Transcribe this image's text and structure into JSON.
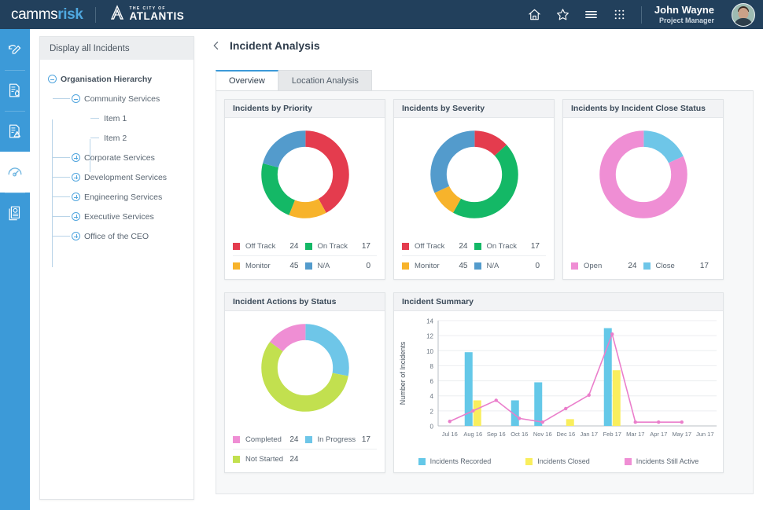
{
  "header": {
    "brand_camms": "camms",
    "brand_risk": "risk",
    "city_sub": "THE CITY OF",
    "city_main": "ATLANTIS",
    "icons": [
      "home-icon",
      "star-icon",
      "hamburger-icon",
      "grid-apps-icon"
    ],
    "user_name": "John Wayne",
    "user_role": "Project Manager"
  },
  "rail": {
    "items": [
      {
        "name": "refresh-edit-icon",
        "active": false
      },
      {
        "name": "document-hand-icon",
        "active": false
      },
      {
        "name": "document-warning-icon",
        "active": false
      },
      {
        "name": "gauge-dashboard-icon",
        "active": true
      },
      {
        "name": "report-badge-icon",
        "active": false
      }
    ]
  },
  "left_panel": {
    "title": "Display all Incidents",
    "tree": [
      {
        "label": "Organisation Hierarchy",
        "state": "expanded",
        "depth": 0,
        "root": true
      },
      {
        "label": "Community Services",
        "state": "expanded",
        "depth": 1,
        "root": false
      },
      {
        "label": "Item 1",
        "state": "leaf",
        "depth": 2,
        "root": false
      },
      {
        "label": "Item 2",
        "state": "leaf",
        "depth": 2,
        "root": false
      },
      {
        "label": "Corporate Services",
        "state": "collapsed",
        "depth": 1,
        "root": false
      },
      {
        "label": "Development Services",
        "state": "collapsed",
        "depth": 1,
        "root": false
      },
      {
        "label": "Engineering Services",
        "state": "collapsed",
        "depth": 1,
        "root": false
      },
      {
        "label": "Executive Services",
        "state": "collapsed",
        "depth": 1,
        "root": false
      },
      {
        "label": "Office of the CEO",
        "state": "collapsed",
        "depth": 1,
        "root": false
      }
    ]
  },
  "main": {
    "back_icon": "chevron-left-icon",
    "page_title": "Incident Analysis",
    "tabs": [
      {
        "label": "Overview",
        "active": true
      },
      {
        "label": "Location Analysis",
        "active": false
      }
    ]
  },
  "colors": {
    "header_bg": "#22405c",
    "rail_bg": "#3c9ad8",
    "accent": "#3c9ad8",
    "red": "#e43c4e",
    "green": "#14b866",
    "orange": "#f7b32b",
    "blue": "#539bcc",
    "pink": "#ef8ed4",
    "lightblue": "#6ec6e8",
    "lime": "#c2e04f",
    "bar_blue": "#64c8e8",
    "bar_yellow": "#f9ee5d",
    "line_pink": "#ea7ecb"
  },
  "chart_data": [
    {
      "type": "pie",
      "id": "incidents-by-priority",
      "title": "Incidents by Priority",
      "labels": [
        "Off Track",
        "On Track",
        "Monitor",
        "N/A"
      ],
      "values": [
        24,
        17,
        45,
        0
      ],
      "colors": [
        "#e43c4e",
        "#14b866",
        "#f7b32b",
        "#539bcc"
      ],
      "slice_order": [
        "Off Track",
        "Monitor",
        "On Track",
        "N/A"
      ],
      "slice_pct": [
        42,
        14,
        23,
        12
      ],
      "legend_position": "bottom",
      "donut": true
    },
    {
      "type": "pie",
      "id": "incidents-by-severity",
      "title": "Incidents by Severity",
      "labels": [
        "Off Track",
        "On Track",
        "Monitor",
        "N/A"
      ],
      "values": [
        24,
        17,
        45,
        0
      ],
      "colors": [
        "#e43c4e",
        "#14b866",
        "#f7b32b",
        "#539bcc"
      ],
      "slice_order": [
        "Off Track",
        "On Track",
        "Monitor",
        "N/A"
      ],
      "slice_pct": [
        13,
        45,
        10,
        32
      ],
      "legend_position": "bottom",
      "donut": true
    },
    {
      "type": "pie",
      "id": "incidents-by-incident-close-status",
      "title": "Incidents by Incident Close Status",
      "labels": [
        "Open",
        "Close"
      ],
      "values": [
        24,
        17
      ],
      "colors": [
        "#ef8ed4",
        "#6ec6e8"
      ],
      "slice_order": [
        "Close",
        "Open"
      ],
      "slice_pct": [
        18,
        82
      ],
      "legend_position": "bottom",
      "donut": true
    },
    {
      "type": "pie",
      "id": "incident-actions-by-status",
      "title": "Incident Actions by Status",
      "labels": [
        "Completed",
        "In Progress",
        "Not Started"
      ],
      "values": [
        24,
        17,
        24
      ],
      "colors": [
        "#ef8ed4",
        "#6ec6e8",
        "#c2e04f"
      ],
      "slice_order": [
        "In Progress",
        "Not Started",
        "Completed"
      ],
      "slice_pct": [
        28,
        57,
        15
      ],
      "legend_position": "bottom",
      "donut": true
    },
    {
      "type": "bar",
      "id": "incident-summary",
      "title": "Incident Summary",
      "xlabel": "",
      "ylabel": "Number of Incidents",
      "ylim": [
        0,
        14
      ],
      "yticks": [
        0,
        2,
        4,
        6,
        8,
        10,
        12,
        14
      ],
      "grid": true,
      "categories": [
        "Jul 16",
        "Aug 16",
        "Sep 16",
        "Oct 16",
        "Nov 16",
        "Dec 16",
        "Jan 17",
        "Feb 17",
        "Mar 17",
        "Apr 17",
        "May 17",
        "Jun 17"
      ],
      "series": [
        {
          "name": "Incidents  Recorded",
          "type": "bar",
          "color": "#64c8e8",
          "values": [
            0,
            9.8,
            0,
            3.4,
            5.8,
            0,
            0,
            13,
            0,
            0,
            0,
            0
          ]
        },
        {
          "name": "Incidents Closed",
          "type": "bar",
          "color": "#f9ee5d",
          "values": [
            0,
            3.4,
            0,
            0,
            0,
            0.9,
            0,
            7.4,
            0,
            0,
            0,
            0
          ]
        },
        {
          "name": "Incidents Still Active",
          "type": "line",
          "color": "#ea7ecb",
          "values": [
            0.6,
            2.0,
            3.4,
            1.0,
            0.5,
            2.3,
            4.1,
            12.2,
            0.5,
            0.5,
            0.5,
            null
          ]
        }
      ],
      "legend_position": "bottom"
    }
  ]
}
